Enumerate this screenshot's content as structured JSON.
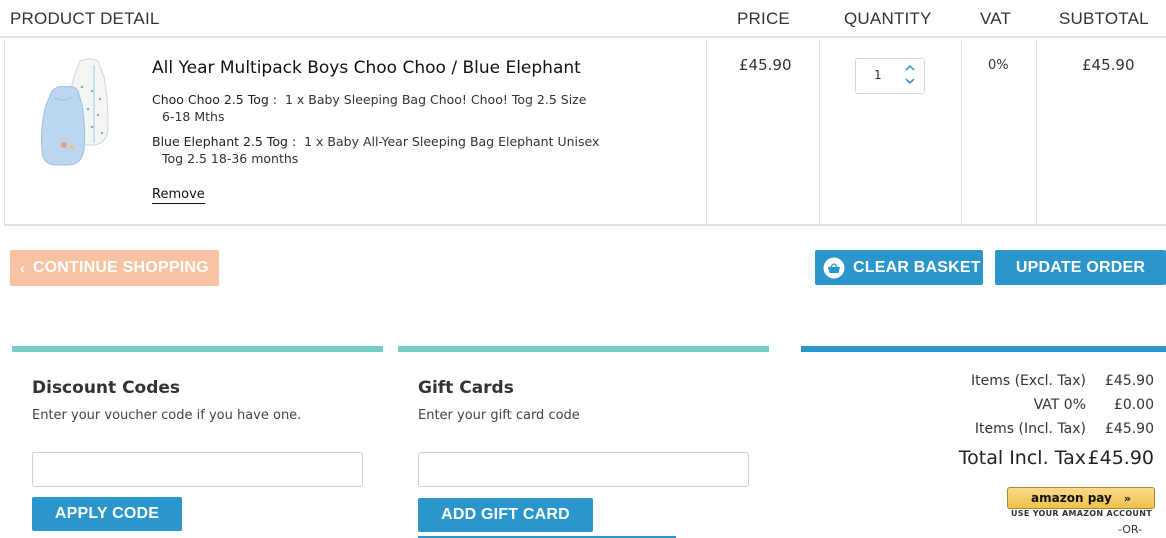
{
  "table": {
    "headers": {
      "product": "PRODUCT DETAIL",
      "price": "PRICE",
      "quantity": "QUANTITY",
      "vat": "VAT",
      "subtotal": "SUBTOTAL"
    },
    "item": {
      "title": "All Year Multipack Boys Choo Choo / Blue Elephant",
      "options": [
        {
          "name": "Choo Choo 2.5 Tog :",
          "desc_line1": "1 x Baby Sleeping Bag Choo! Choo! Tog 2.5 Size",
          "desc_line2": "6-18 Mths"
        },
        {
          "name": "Blue Elephant 2.5 Tog :",
          "desc_line1": "1 x Baby All-Year Sleeping Bag Elephant Unisex",
          "desc_line2": "Tog 2.5 18-36 months"
        }
      ],
      "remove_label": "Remove",
      "price": "£45.90",
      "quantity": "1",
      "vat": "0%",
      "subtotal": "£45.90"
    }
  },
  "actions": {
    "continue_label": "CONTINUE SHOPPING",
    "clear_label": "CLEAR BASKET",
    "update_label": "UPDATE ORDER"
  },
  "discount": {
    "title": "Discount Codes",
    "hint": "Enter your voucher code if you have one.",
    "value": "",
    "button_label": "APPLY CODE"
  },
  "gift": {
    "title": "Gift Cards",
    "hint": "Enter your gift card code",
    "value": "",
    "button_label": "ADD GIFT CARD"
  },
  "totals": {
    "rows": [
      {
        "label": "Items (Excl. Tax)",
        "value": "£45.90"
      },
      {
        "label": "VAT 0%",
        "value": "£0.00"
      },
      {
        "label": "Items (Incl. Tax)",
        "value": "£45.90"
      }
    ],
    "total_label": "Total Incl. Tax",
    "total_value": "£45.90",
    "amazon_label": "amazon pay",
    "amazon_caption": "USE YOUR AMAZON ACCOUNT",
    "or_text": "-OR-"
  },
  "colors": {
    "primary": "#2b96cc",
    "continue": "#f8c3a2",
    "panel_accent": "#76cfc6"
  },
  "icons": {
    "continue": "chevron-left-icon",
    "clear": "basket-icon",
    "qty_up": "chevron-up-icon",
    "qty_down": "chevron-down-icon",
    "amazon": "double-chevron-right-icon"
  }
}
